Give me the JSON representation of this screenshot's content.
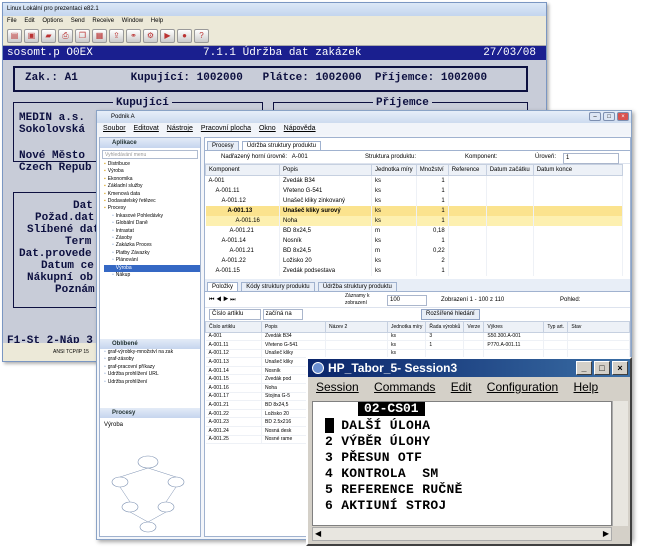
{
  "w1": {
    "title": "Linux Lokální pro prezentaci e82.1",
    "menu": [
      "File",
      "Edit",
      "Options",
      "Send",
      "Receive",
      "Window",
      "Help"
    ],
    "hdr_left": "sosomt.p O0EX",
    "hdr_center": "7.1.1 Údržba dat zakázek",
    "hdr_date": "27/03/08",
    "line_zak": "Zak.: A1        Kupující: 1002000   Plátce: 1002000  Příjemce: 1002000",
    "label_kupujici": "Kupující",
    "label_prijemce": "Příjemce",
    "addr1": "MEDIN a.s.",
    "addr2": "Sokolovská",
    "addr3": "Nové Město",
    "addr4": "Czech Repub",
    "f1": "Dat",
    "f2": "Požad.dat",
    "f3": "Slíbené dat",
    "f4": "Term",
    "f5": "Dat.provede",
    "f6": "Datum ce",
    "f7": "Nákupní ob",
    "f8": "Poznám",
    "footer": "F1-St 2-Náp 3",
    "status": "ANSI   TCP/IP   15"
  },
  "w2": {
    "title": "Podnik A",
    "menu": [
      "Soubor",
      "Editovat",
      "Nástroje",
      "Pracovní plocha",
      "Okno",
      "Nápověda"
    ],
    "apps_title": "Aplikace",
    "search_placeholder": "Vyhledávání menu",
    "tree": [
      "Distribuce",
      "Výroba",
      "Ekonomika",
      "Základní služby",
      "Kmenová data",
      "Dodavatelský řetězec",
      "Procesy",
      "Inkasové Pohledávky",
      "Globální Daně",
      "Intrastat",
      "Zásoby",
      "Zakázka Proces",
      "Platby Závazky",
      "Plánování",
      "Výroba",
      "Nákup"
    ],
    "fav_title": "Oblíbené",
    "favs": [
      "graf-výrobky-množství na zak",
      "graf-zásoby",
      "graf-pracovní příkazy",
      "Údržba prohlížení URL",
      "Údržba prohlížení"
    ],
    "proc_title": "Procesy",
    "proc_label": "Výroba",
    "tabs": [
      "Procesy",
      "Údržba struktury produktu"
    ],
    "nadrazeny_label": "Nadřazený horní úrovně:",
    "nadrazeny_val": "A-001",
    "struktura_label": "Struktura produktu:",
    "komponent_label": "Komponent:",
    "uroven_label": "Úroveň:",
    "uroven_val": "1",
    "cols1": [
      "Komponent",
      "Popis",
      "Jednotka míry",
      "Množství",
      "Reference",
      "Datum začátku",
      "Datum konce"
    ],
    "rows1": [
      [
        "A-001",
        "Zvedák B34",
        "ks",
        "1"
      ],
      [
        "A-001.11",
        "Vřeteno G-541",
        "ks",
        "1"
      ],
      [
        "A-001.12",
        "Unašeč kliky zinkovaný",
        "ks",
        "1"
      ],
      [
        "A-001.13",
        "Unašeč kliky surový",
        "ks",
        "1"
      ],
      [
        "A-001.16",
        "Noha",
        "ks",
        "1"
      ],
      [
        "A-001.21",
        "BD 8x24,5",
        "m",
        "0,18"
      ],
      [
        "A-001.14",
        "Nosník",
        "ks",
        "1"
      ],
      [
        "A-001.21",
        "BD 8x24,5",
        "m",
        "0,22"
      ],
      [
        "A-001.22",
        "Ložisko 20",
        "ks",
        "2"
      ],
      [
        "A-001.15",
        "Zvedák podsestava",
        "ks",
        "1"
      ]
    ],
    "subtabs": [
      "Položky",
      "Kódy struktury produktu",
      "Údržba struktury produktu"
    ],
    "zaznamy_label": "Záznamy k zobrazení",
    "zaznamy_val": "100",
    "zobrazeni": "Zobrazení 1 - 100 z 110",
    "pohled": "Pohled:",
    "filter_field": "Číslo artiklu",
    "filter_op": "začíná na",
    "filter_btn": "Rozšířené hledání",
    "cols2": [
      "Číslo artiklu",
      "Popis",
      "Název 2",
      "Jednotka míry",
      "Řada výrobků",
      "Verze",
      "Výkres",
      "Typ art.",
      "Stav"
    ],
    "rows2": [
      [
        "A-001",
        "Zvedák B34",
        "ks",
        "3",
        "",
        "S50.300.A-001"
      ],
      [
        "A-001.11",
        "Vřeteno G-541",
        "ks",
        "1",
        "",
        "P770.A-001.11"
      ],
      [
        "A-001.12",
        "Unašeč kliky",
        "ks",
        "",
        ""
      ],
      [
        "A-001.13",
        "Unašeč kliky",
        "ks",
        "",
        ""
      ],
      [
        "A-001.14",
        "Nosník",
        "ks",
        "",
        ""
      ],
      [
        "A-001.15",
        "Zvedák pod",
        "ks",
        "",
        ""
      ],
      [
        "A-001.16",
        "Noha",
        "ks",
        "",
        ""
      ],
      [
        "A-001.17",
        "Stojina G-5",
        "ks",
        "",
        ""
      ],
      [
        "A-001.21",
        "BD 8x24,5",
        "m",
        "",
        ""
      ],
      [
        "A-001.22",
        "Ložisko 20",
        "ks",
        "",
        ""
      ],
      [
        "A-001.23",
        "BD 2.5x216",
        "ks",
        "",
        ""
      ],
      [
        "A-001.24",
        "Nosná desk",
        "ks",
        "",
        ""
      ],
      [
        "A-001.25",
        "Nosné rame",
        "ks",
        "",
        ""
      ]
    ]
  },
  "w3": {
    "title": "HP_Tabor_5- Session3",
    "menu": [
      "Session",
      "Commands",
      "Edit",
      "Configuration",
      "Help"
    ],
    "screen_title": "02-CS01",
    "items": [
      "1 DALŠÍ ÚLOHA",
      "2 VÝBĚR ÚLOHY",
      "3 PŘESUN OTF",
      "4 KONTROLA  SM",
      "5 REFERENCE RUČNĚ",
      "6 AKTIUNÍ STROJ"
    ]
  }
}
